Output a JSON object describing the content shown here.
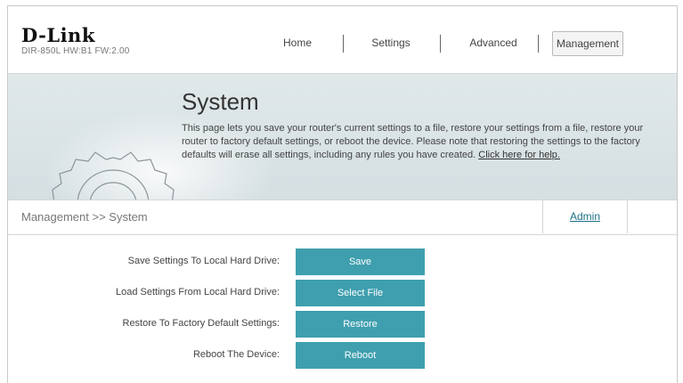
{
  "header": {
    "brand": "D-Link",
    "model_info": "DIR-850L   HW:B1   FW:2.00",
    "nav": [
      {
        "label": "Home"
      },
      {
        "label": "Settings"
      },
      {
        "label": "Advanced"
      },
      {
        "label": "Management",
        "active": true
      }
    ]
  },
  "banner": {
    "title": "System",
    "description": "This page lets you save your router's current settings to a file, restore your settings from a file, restore your router to factory default settings, or reboot the device. Please note that restoring the settings to the factory defaults will erase all settings, including any rules you have created.",
    "help_link": "Click here for help.",
    "icon": "gear-icon"
  },
  "breadcrumb": {
    "path": "Management >> System",
    "admin_tab": "Admin"
  },
  "actions": [
    {
      "label": "Save Settings To Local Hard Drive:",
      "button": "Save"
    },
    {
      "label": "Load Settings From Local Hard Drive:",
      "button": "Select File"
    },
    {
      "label": "Restore To Factory Default Settings:",
      "button": "Restore"
    },
    {
      "label": "Reboot The Device:",
      "button": "Reboot"
    }
  ],
  "colors": {
    "accent": "#3f9fae",
    "banner_bg": "#d9e2e5",
    "link": "#1b6f86"
  }
}
